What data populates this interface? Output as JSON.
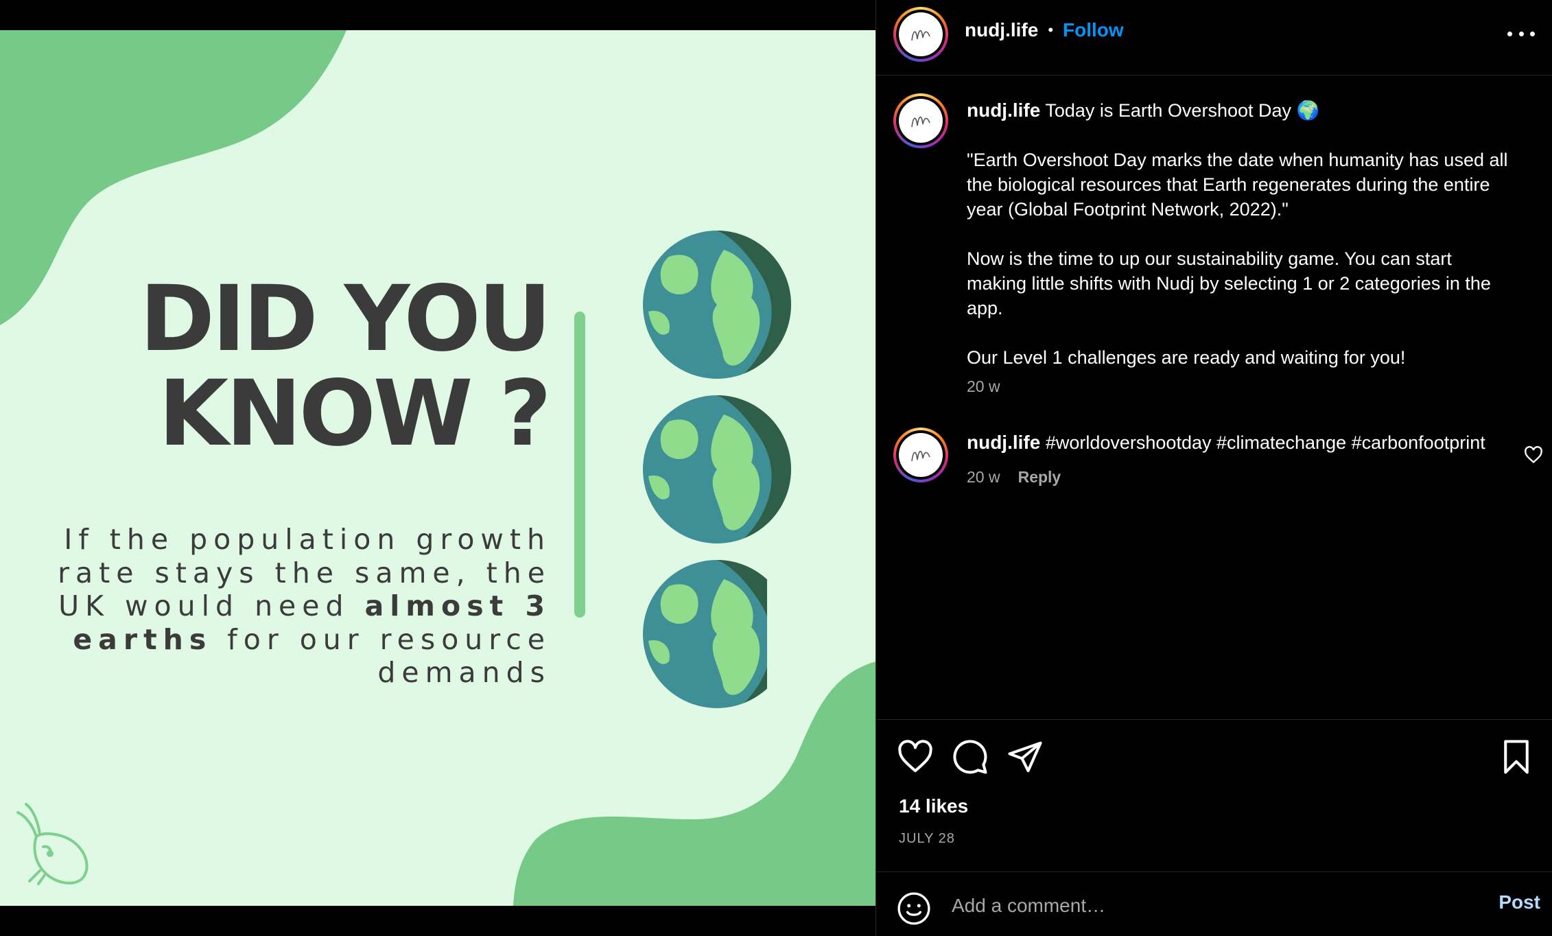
{
  "post": {
    "image": {
      "headline_line1": "DID YOU",
      "headline_line2": "KNOW ?",
      "body_part1": "If the population growth rate stays the same, the UK would need ",
      "body_bold": "almost 3 earths",
      "body_part2": " for our resource demands",
      "colors": {
        "background": "#e0f9e5",
        "blob": "#76c987",
        "text": "#3b3b3b",
        "globe_ocean": "#3f8f96",
        "globe_land": "#8fdc8c"
      },
      "globe_count": 3,
      "last_globe_fraction": 0.83
    }
  },
  "header": {
    "username": "nudj.life",
    "separator": "•",
    "follow_label": "Follow"
  },
  "caption": {
    "username": "nudj.life",
    "first_line": "Today is Earth Overshoot Day 🌍",
    "para1": "\"Earth Overshoot Day marks the date when humanity has used all the biological resources that Earth regenerates during the entire year (Global Footprint Network, 2022).\"",
    "para2": "Now is the time to up our sustainability game. You can start making little shifts with Nudj by selecting 1 or 2 categories in the app.",
    "para3": "Our Level 1 challenges are ready and waiting for you!",
    "time": "20 w"
  },
  "comment": {
    "username": "nudj.life",
    "text": "#worldovershootday #climatechange #carbonfootprint",
    "time": "20 w",
    "reply_label": "Reply"
  },
  "actions": {
    "likes": "14 likes",
    "date": "JULY 28"
  },
  "comment_bar": {
    "placeholder": "Add a comment…",
    "post_label": "Post"
  }
}
